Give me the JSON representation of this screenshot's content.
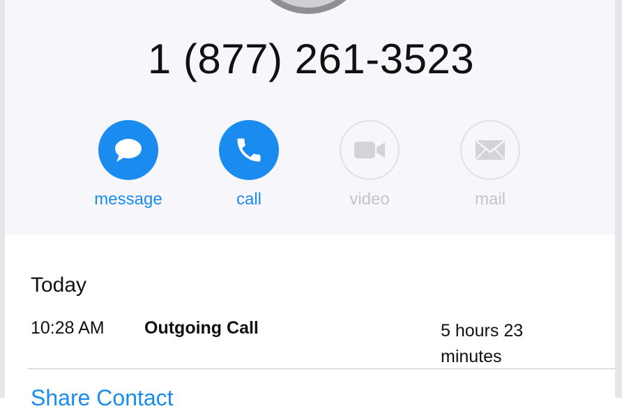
{
  "contact": {
    "phone_number": "1 (877) 261-3523"
  },
  "actions": [
    {
      "label": "message",
      "icon": "speech-bubble-icon",
      "enabled": true
    },
    {
      "label": "call",
      "icon": "phone-icon",
      "enabled": true
    },
    {
      "label": "video",
      "icon": "video-camera-icon",
      "enabled": false
    },
    {
      "label": "mail",
      "icon": "envelope-icon",
      "enabled": false
    }
  ],
  "history": {
    "heading": "Today",
    "entries": [
      {
        "time": "10:28 AM",
        "type": "Outgoing Call",
        "duration": "5 hours 23 minutes"
      }
    ]
  },
  "links": {
    "share_contact": "Share Contact"
  },
  "colors": {
    "accent": "#1a8cf0",
    "disabled": "#c4c4c9",
    "header_background": "#f7f7fb"
  }
}
